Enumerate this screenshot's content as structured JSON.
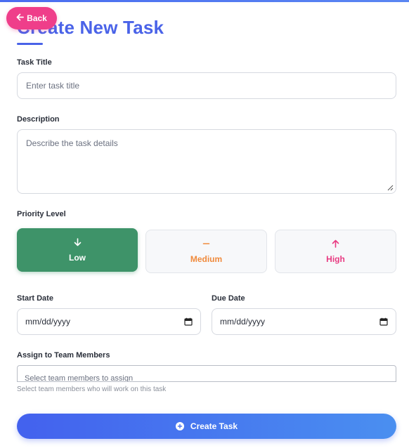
{
  "back_button": {
    "label": "Back"
  },
  "page": {
    "title": "Create New Task"
  },
  "form": {
    "title_field": {
      "label": "Task Title",
      "placeholder": "Enter task title"
    },
    "description_field": {
      "label": "Description",
      "placeholder": "Describe the task details"
    },
    "priority": {
      "label": "Priority Level",
      "options": [
        {
          "label": "Low",
          "icon": "arrow-down-icon",
          "selected": true,
          "color": "#3e9369"
        },
        {
          "label": "Medium",
          "icon": "minus-icon",
          "selected": false,
          "color": "#f08a3c"
        },
        {
          "label": "High",
          "icon": "arrow-up-icon",
          "selected": false,
          "color": "#e83b82"
        }
      ]
    },
    "start_date": {
      "label": "Start Date",
      "value": "mm/dd/yyyy"
    },
    "due_date": {
      "label": "Due Date",
      "value": "mm/dd/yyyy"
    },
    "assign": {
      "label": "Assign to Team Members",
      "placeholder": "Select team members to assign",
      "helper": "Select team members who will work on this task"
    },
    "submit": {
      "label": "Create Task"
    }
  },
  "colors": {
    "accent": "#4a63e8",
    "back_button": "#ef3e8a"
  }
}
